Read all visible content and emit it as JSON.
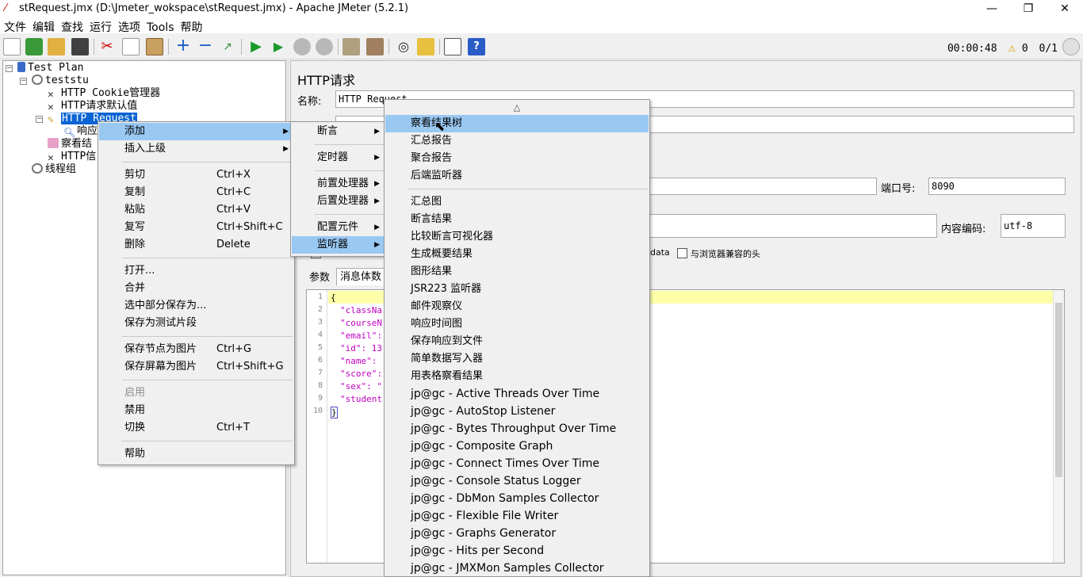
{
  "window": {
    "title": "stRequest.jmx (D:\\Jmeter_wokspace\\stRequest.jmx) - Apache JMeter (5.2.1)",
    "minimize": "—",
    "maximize": "❐",
    "close": "✕"
  },
  "menubar": [
    "文件",
    "编辑",
    "查找",
    "运行",
    "选项",
    "Tools",
    "帮助"
  ],
  "toolbar": {
    "timer": "00:00:48",
    "warnings": "0",
    "threads": "0/1"
  },
  "tree": {
    "items": [
      {
        "label": "Test Plan"
      },
      {
        "label": "teststu"
      },
      {
        "label": "HTTP Cookie管理器"
      },
      {
        "label": "HTTP请求默认值"
      },
      {
        "label": "HTTP Request"
      },
      {
        "label": "响应"
      },
      {
        "label": "察看结"
      },
      {
        "label": "HTTP信"
      },
      {
        "label": "线程组"
      }
    ]
  },
  "panel": {
    "heading": "HTTP请求",
    "name_label": "名称:",
    "name_value": "HTTP Request",
    "port_label": "端口号:",
    "port_value": "8090",
    "encoding_label": "内容编码:",
    "encoding_value": "utf-8",
    "data_text": "data",
    "browser_headers": "与浏览器兼容的头",
    "tab_params": "参数",
    "tab_body": "消息体数"
  },
  "editor": {
    "line_numbers": [
      "1",
      "2",
      "3",
      "4",
      "5",
      "6",
      "7",
      "8",
      "9",
      "10"
    ],
    "lines": [
      "{",
      "\"classNa",
      "\"courseN",
      "\"email\":",
      "\"id\": 13",
      "\"name\": ",
      "\"score\":",
      "\"sex\": \"",
      "\"student",
      "}"
    ]
  },
  "context_menu": {
    "items": [
      {
        "label": "添加",
        "shortcut": "",
        "submenu": true
      },
      {
        "label": "插入上级",
        "shortcut": "",
        "submenu": true
      },
      {
        "label": "剪切",
        "shortcut": "Ctrl+X"
      },
      {
        "label": "复制",
        "shortcut": "Ctrl+C"
      },
      {
        "label": "粘贴",
        "shortcut": "Ctrl+V"
      },
      {
        "label": "复写",
        "shortcut": "Ctrl+Shift+C"
      },
      {
        "label": "删除",
        "shortcut": "Delete"
      },
      {
        "label": "打开...",
        "shortcut": ""
      },
      {
        "label": "合并",
        "shortcut": ""
      },
      {
        "label": "选中部分保存为...",
        "shortcut": ""
      },
      {
        "label": "保存为测试片段",
        "shortcut": ""
      },
      {
        "label": "保存节点为图片",
        "shortcut": "Ctrl+G"
      },
      {
        "label": "保存屏幕为图片",
        "shortcut": "Ctrl+Shift+G"
      },
      {
        "label": "启用",
        "shortcut": ""
      },
      {
        "label": "禁用",
        "shortcut": ""
      },
      {
        "label": "切换",
        "shortcut": "Ctrl+T"
      },
      {
        "label": "帮助",
        "shortcut": ""
      }
    ]
  },
  "add_submenu": {
    "items": [
      {
        "label": "断言"
      },
      {
        "label": "定时器"
      },
      {
        "label": "前置处理器"
      },
      {
        "label": "后置处理器"
      },
      {
        "label": "配置元件"
      },
      {
        "label": "监听器"
      }
    ]
  },
  "listener_submenu": {
    "scroll_up": "△",
    "items": [
      "察看结果树",
      "汇总报告",
      "聚合报告",
      "后端监听器",
      "汇总图",
      "断言结果",
      "比较断言可视化器",
      "生成概要结果",
      "图形结果",
      "JSR223 监听器",
      "邮件观察仪",
      "响应时间图",
      "保存响应到文件",
      "简单数据写入器",
      "用表格察看结果",
      "jp@gc - Active Threads Over Time",
      "jp@gc - AutoStop Listener",
      "jp@gc - Bytes Throughput Over Time",
      "jp@gc - Composite Graph",
      "jp@gc - Connect Times Over Time",
      "jp@gc - Console Status Logger",
      "jp@gc - DbMon Samples Collector",
      "jp@gc - Flexible File Writer",
      "jp@gc - Graphs Generator",
      "jp@gc - Hits per Second",
      "jp@gc - JMXMon Samples Collector"
    ]
  }
}
